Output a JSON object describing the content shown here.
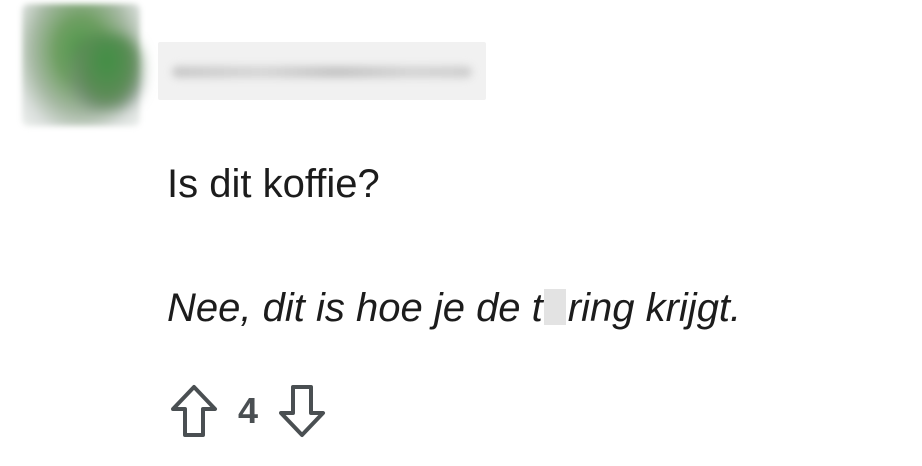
{
  "comment": {
    "line1": "Is dit koffie?",
    "line2_before": "Nee, dit is hoe je de t",
    "line2_after": "ring krijgt.",
    "vote_count": "4"
  },
  "icons": {
    "upvote": "arrow-up-outline-icon",
    "downvote": "arrow-down-outline-icon"
  },
  "colors": {
    "text": "#1c1c1c",
    "icon": "#4a4f52"
  }
}
